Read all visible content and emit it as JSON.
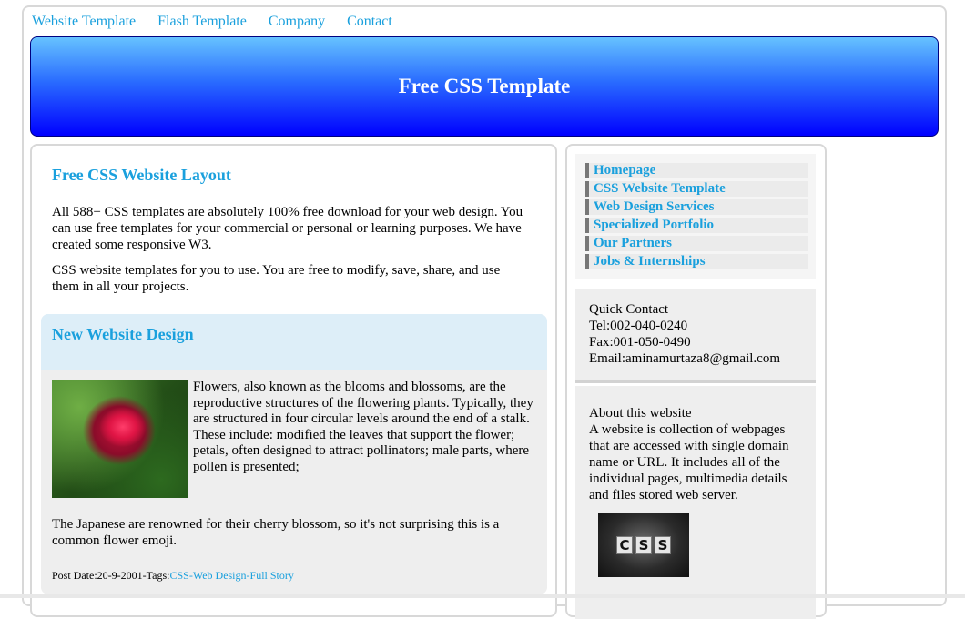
{
  "topnav": {
    "links": [
      "Website Template",
      "Flash Template",
      "Company",
      "Contact"
    ]
  },
  "banner": {
    "title": "Free CSS Template"
  },
  "main": {
    "heading": "Free CSS Website Layout",
    "paragraph1": "All 588+ CSS templates are absolutely 100% free download for your web design. You can use free templates for your commercial or personal or learning purposes. We have created some responsive W3.",
    "paragraph2": "CSS website templates for you to use. You are free to modify, save, share, and use them in all your projects."
  },
  "article": {
    "heading": "New Website Design",
    "flower_text1": "Flowers, also known as the blooms and blossoms, are the reproductive structures of the flowering plants. Typically, they are structured in four circular levels around the end of a stalk.",
    "flower_text2": "These include: modified the leaves that support the flower; petals, often designed to attract pollinators; male parts, where pollen is presented;",
    "japan_text": "The Japanese are renowned for their cherry blossom, so it's not surprising this is a common flower emoji.",
    "post_date_prefix": "Post Date:20-9-2001-Tags:",
    "post_date_link": "CSS-Web Design-Full Story"
  },
  "sidebar": {
    "menu": [
      "Homepage",
      "CSS Website Template",
      "Web Design Services",
      "Specialized Portfolio",
      "Our Partners",
      "Jobs & Internships"
    ],
    "contact": {
      "title": "Quick Contact",
      "tel": "Tel:002-040-0240",
      "fax": "Fax:001-050-0490",
      "email": "Email:aminamurtaza8@gmail.com"
    },
    "about": {
      "title": "About this website",
      "text": "A website is collection of webpages that are accessed with single domain name or URL. It includes all of the individual pages, multimedia details and files stored web server."
    },
    "css_image_letters": [
      "C",
      "S",
      "S"
    ]
  },
  "colors": {
    "link": "#1aa0dd",
    "banner_top": "#66c2ff",
    "banner_bottom": "#0000ff",
    "article_head_bg": "#ddeef8",
    "panel_bg": "#eeeeee"
  },
  "icons": {
    "flower_image": "red-rose-photo",
    "css_image": "css-logo-photo"
  }
}
